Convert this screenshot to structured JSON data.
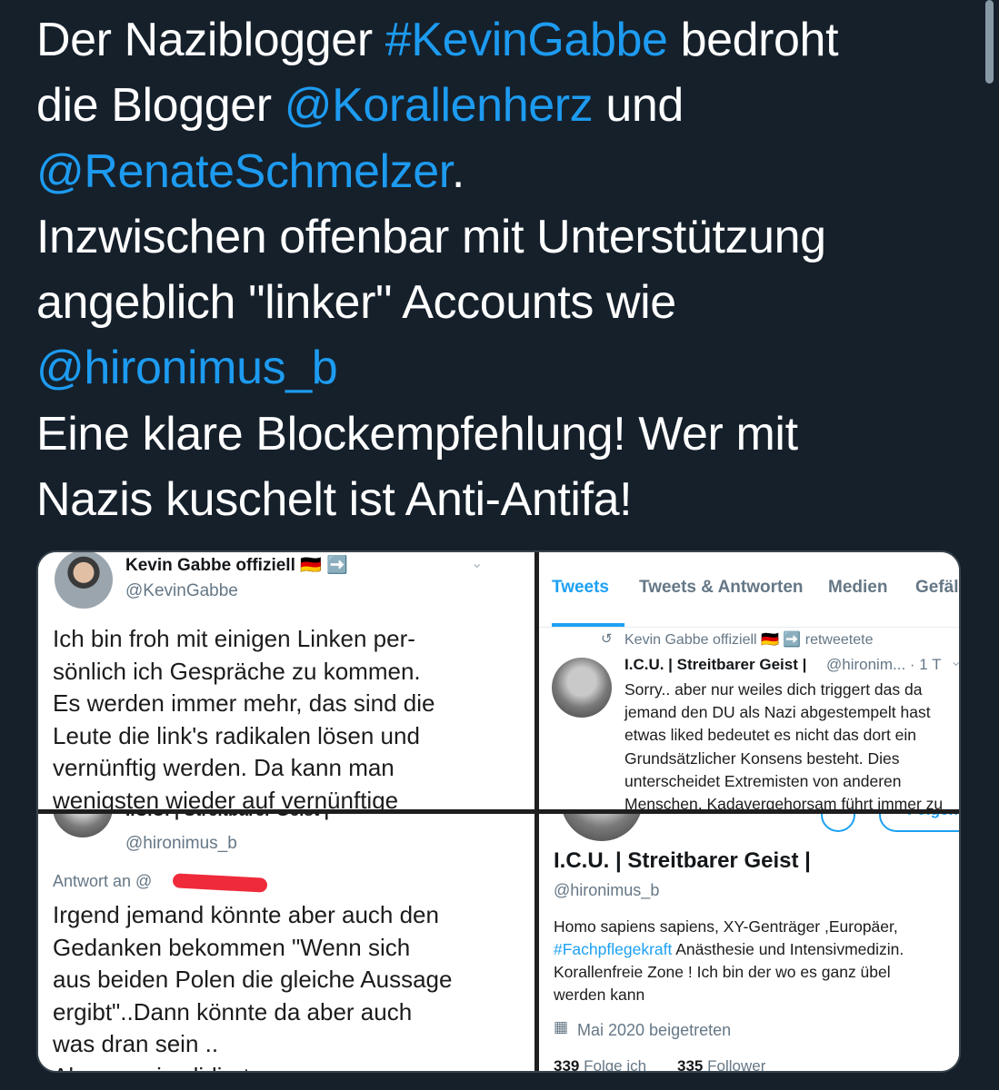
{
  "tweet": {
    "l1_a": "Der Naziblogger ",
    "l1_tag": "#KevinGabbe",
    "l1_b": " bedroht",
    "l2_a": "die Blogger ",
    "l2_m1": "@Korallenherz",
    "l2_b": " und",
    "l3_m": "@RenateSchmelzer",
    "l3_b": ".",
    "l4": "Inzwischen offenbar mit Unterstützung",
    "l5": "angeblich \"linker\" Accounts wie",
    "l6_m": "@hironimus_b",
    "l7": "Eine klare Blockempfehlung! Wer mit",
    "l8": "Nazis kuschelt ist Anti-Antifa!"
  },
  "panel1": {
    "name": "Kevin Gabbe offiziell 🇩🇪 ➡️",
    "handle": "@KevinGabbe",
    "lines": [
      "Ich bin froh mit einigen Linken per-",
      "sönlich ich Gespräche zu kommen.",
      "Es werden immer mehr, das sind die",
      "Leute die link's radikalen lösen und",
      "vernünftig werden. Da kann man",
      "wenigsten wieder auf vernünftige"
    ]
  },
  "panel2": {
    "tabs": [
      "Tweets",
      "Tweets & Antworten",
      "Medien",
      "Gefällt mir"
    ],
    "retweet_label": "Kevin Gabbe offiziell 🇩🇪 ➡️ retweetete",
    "name": "I.C.U. | Streitbarer Geist |",
    "handle_time": "@hironim... · 1 T",
    "lines": [
      "Sorry.. aber nur weiles dich triggert das da",
      "jemand den DU als Nazi abgestempelt hast",
      "etwas liked bedeutet es nicht das dort ein",
      "Grundsätzlicher Konsens besteht. Dies",
      "unterscheidet Extremisten von anderen",
      "Menschen. Kadavergehorsam führt immer zu"
    ]
  },
  "panel3": {
    "name_cut": "I.C.U. | Streitbarer Geist |",
    "handle": "@hironimus_b",
    "reply_to": "Antwort an @",
    "lines": [
      "Irgend jemand könnte aber auch den",
      "Gedanken bekommen  \"Wenn sich",
      "aus beiden Polen die gleiche Aussage",
      "ergibt\"..Dann könnte da aber auch",
      "was dran sein ..",
      "Also quasi validiert"
    ]
  },
  "panel4": {
    "follow_button": "Folgen",
    "name": "I.C.U. | Streitbarer Geist |",
    "handle": "@hironimus_b",
    "bio_1": "Homo sapiens sapiens, XY-Genträger ,Europäer,",
    "bio_tag": "#Fachpflegekraft",
    "bio_2": " Anästhesie und Intensivmedizin.",
    "bio_3": "Korallenfreie Zone ! Ich bin der wo es ganz übel",
    "bio_4": "werden kann",
    "joined": "Mai 2020 beigetreten",
    "following_count": "339",
    "following_label": "Folge ich",
    "followers_count": "335",
    "followers_label": "Follower"
  }
}
